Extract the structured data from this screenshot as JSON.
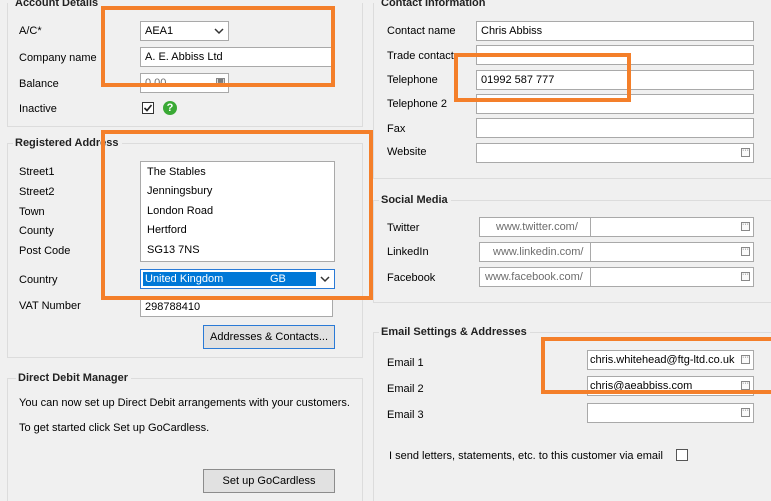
{
  "account": {
    "title": "Account Details",
    "ac_label": "A/C*",
    "ac_value": "AEA1",
    "company_label": "Company name",
    "company_value": "A. E. Abbiss Ltd",
    "balance_label": "Balance",
    "balance_value": "0.00",
    "inactive_label": "Inactive",
    "help_glyph": "?"
  },
  "registered": {
    "title": "Registered Address",
    "labels": [
      "Street1",
      "Street2",
      "Town",
      "County",
      "Post Code"
    ],
    "lines": [
      "The Stables",
      "Jenningsbury",
      "London Road",
      "Hertford",
      "SG13 7NS"
    ],
    "country_label": "Country",
    "country_value": "United Kingdom",
    "country_code": "GB",
    "vat_label": "VAT Number",
    "vat_value": "298788410",
    "addresses_button": "Addresses & Contacts..."
  },
  "direct_debit": {
    "title": "Direct Debit Manager",
    "line1": "You can now set up Direct Debit arrangements with your customers.",
    "line2": "To get started click Set up GoCardless.",
    "button": "Set up GoCardless"
  },
  "contact": {
    "title": "Contact Information",
    "contact_label": "Contact name",
    "contact_value": "Chris Abbiss",
    "trade_label": "Trade contact",
    "telephone_label": "Telephone",
    "telephone_value": "01992 587 777",
    "telephone2_label": "Telephone 2",
    "fax_label": "Fax",
    "website_label": "Website"
  },
  "social": {
    "title": "Social Media",
    "twitter_label": "Twitter",
    "twitter_placeholder": "www.twitter.com/",
    "linkedin_label": "LinkedIn",
    "linkedin_placeholder": "www.linkedin.com/",
    "facebook_label": "Facebook",
    "facebook_placeholder": "www.facebook.com/"
  },
  "email": {
    "title": "Email Settings & Addresses",
    "email1_label": "Email 1",
    "email1_value": "chris.whitehead@ftg-ltd.co.uk",
    "email2_label": "Email 2",
    "email2_value": "chris@aeabbiss.com",
    "email3_label": "Email 3",
    "send_label": "I send letters, statements, etc. to this customer via email"
  },
  "colors": {
    "highlight_orange": "#f47f2a",
    "selection_blue": "#0078d7",
    "help_green": "#3aa935"
  }
}
